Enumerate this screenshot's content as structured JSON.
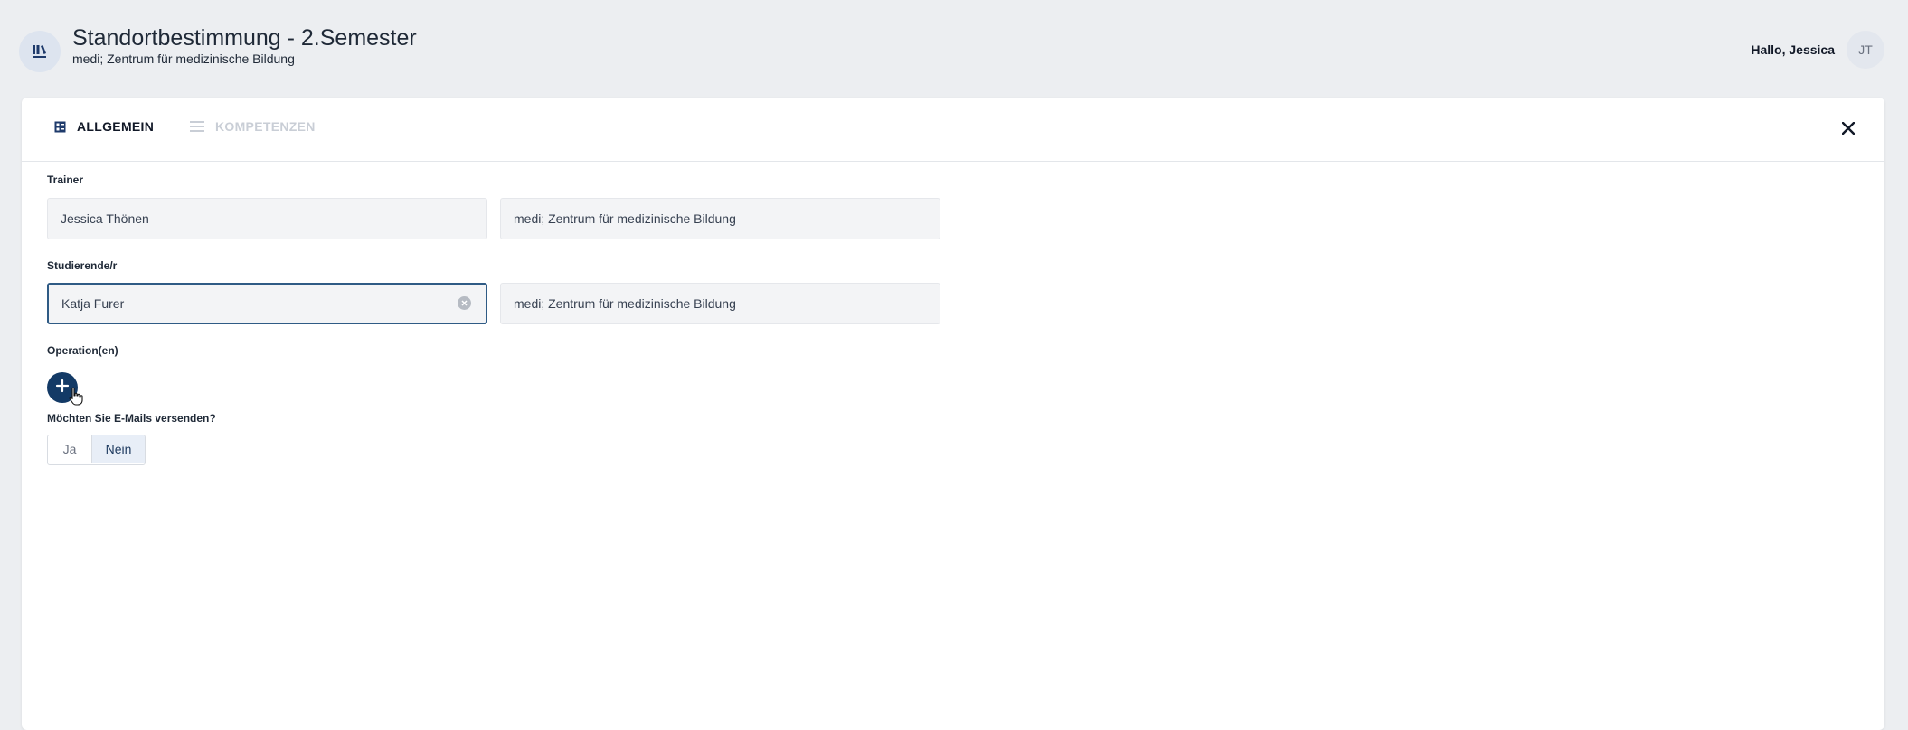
{
  "header": {
    "logo_icon": "library-books-icon",
    "title": "Standortbestimmung - 2.Semester",
    "subtitle": "medi; Zentrum für medizinische Bildung",
    "greeting": "Hallo, Jessica",
    "avatar_initials": "JT"
  },
  "tabs": [
    {
      "label": "ALLGEMEIN",
      "icon": "form-icon",
      "active": true
    },
    {
      "label": "KOMPETENZEN",
      "icon": "list-icon",
      "active": false
    }
  ],
  "form": {
    "trainer": {
      "label": "Trainer",
      "name_value": "Jessica Thönen",
      "institution_value": "medi; Zentrum für medizinische Bildung"
    },
    "student": {
      "label": "Studierende/r",
      "name_value": "Katja Furer",
      "institution_value": "medi; Zentrum für medizinische Bildung"
    },
    "operations": {
      "label": "Operation(en)",
      "add_icon": "plus-icon"
    },
    "email": {
      "label": "Möchten Sie E-Mails versenden?",
      "options": [
        "Ja",
        "Nein"
      ],
      "selected": "Nein"
    }
  },
  "colors": {
    "primary": "#133a66",
    "background": "#eceef1",
    "card": "#ffffff",
    "active_border": "#2f5b85",
    "selected_toggle": "#e8eef7"
  }
}
